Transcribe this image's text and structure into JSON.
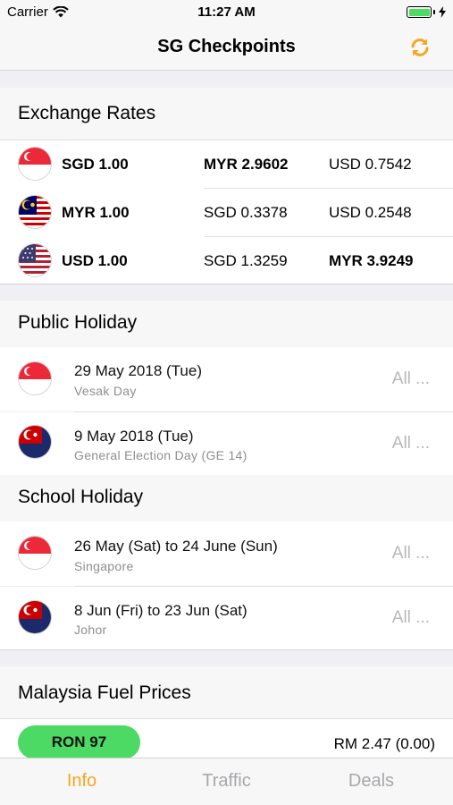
{
  "status": {
    "carrier": "Carrier",
    "time": "11:27 AM"
  },
  "nav": {
    "title": "SG Checkpoints",
    "refresh_icon": "refresh-icon"
  },
  "exchange": {
    "title": "Exchange Rates",
    "rows": [
      {
        "flag": "singapore",
        "base": "SGD 1.00",
        "c1": "MYR 2.9602",
        "c2": "USD 0.7542"
      },
      {
        "flag": "malaysia",
        "base": "MYR 1.00",
        "c1": "SGD 0.3378",
        "c2": "USD 0.2548"
      },
      {
        "flag": "usa",
        "base": "USD 1.00",
        "c1": "SGD 1.3259",
        "c2": "MYR 3.9249"
      }
    ]
  },
  "public_holiday": {
    "title": "Public Holiday",
    "items": [
      {
        "flag": "singapore",
        "title": "29 May 2018 (Tue)",
        "subtitle": "Vesak Day",
        "scope": "All ..."
      },
      {
        "flag": "johor",
        "title": "9 May 2018 (Tue)",
        "subtitle": "General Election Day (GE 14)",
        "scope": "All ..."
      }
    ]
  },
  "school_holiday": {
    "title": "School Holiday",
    "items": [
      {
        "flag": "singapore",
        "title": "26 May (Sat) to 24 June (Sun)",
        "subtitle": "Singapore",
        "scope": "All ..."
      },
      {
        "flag": "johor",
        "title": "8 Jun (Fri) to 23 Jun (Sat)",
        "subtitle": "Johor",
        "scope": "All ..."
      }
    ]
  },
  "fuel": {
    "title": "Malaysia Fuel Prices",
    "items": [
      {
        "grade": "RON 97",
        "price": "RM 2.47 (0.00)"
      }
    ]
  },
  "tabs": [
    {
      "label": "Info",
      "active": true
    },
    {
      "label": "Traffic",
      "active": false
    },
    {
      "label": "Deals",
      "active": false
    }
  ],
  "colors": {
    "accent": "#f5a623",
    "fuel_pill": "#4cd964",
    "muted": "#8e8e93"
  }
}
